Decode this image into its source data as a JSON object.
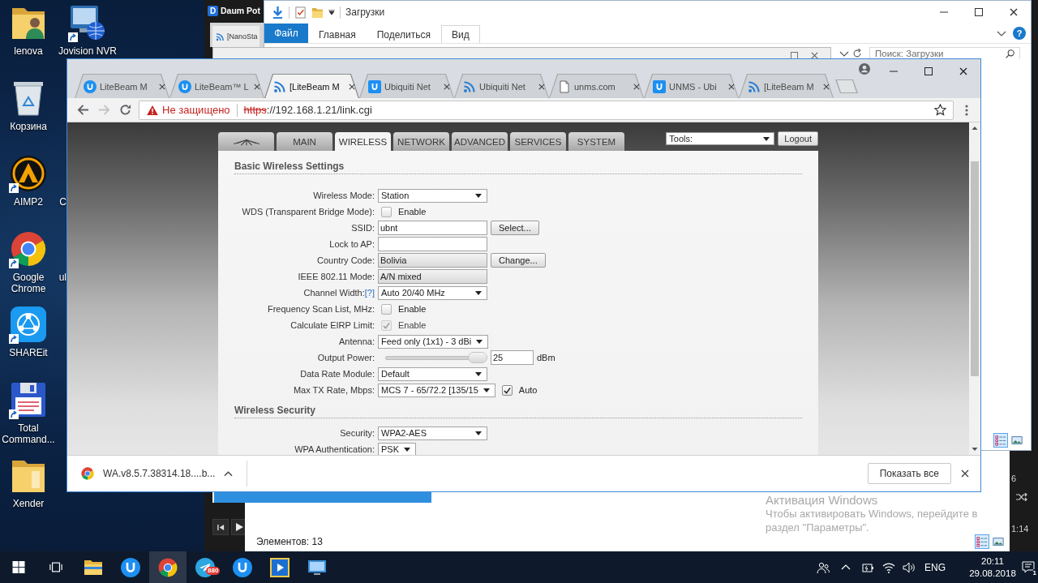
{
  "desktop": {
    "icons": [
      {
        "label": "lenova",
        "kind": "user-folder",
        "shortcut": false
      },
      {
        "label": "Jovision NVR",
        "kind": "nvr",
        "shortcut": true
      },
      {
        "label": "Корзина",
        "kind": "recycle-bin",
        "shortcut": false
      },
      {
        "label": "AIMP2",
        "kind": "aimp",
        "shortcut": true
      },
      {
        "label": "Google Chrome",
        "kind": "chrome",
        "shortcut": true
      },
      {
        "label": "SHAREit",
        "kind": "shareit",
        "shortcut": true
      },
      {
        "label": "Total Command...",
        "kind": "floppy",
        "shortcut": true
      },
      {
        "label": "Xender",
        "kind": "folder",
        "shortcut": false
      }
    ],
    "cut_labels": [
      "C",
      "ul"
    ]
  },
  "player_window": {
    "logo": "D",
    "title": "Daum Pot",
    "counter": "6",
    "time": "1:14"
  },
  "explorer_behind": {
    "status": "Элементов: 13",
    "views": [
      {
        "kind": "details",
        "selected": true
      },
      {
        "kind": "thumbnails",
        "selected": false
      }
    ]
  },
  "background_browser": {
    "tab": "[NanoSta"
  },
  "explorer": {
    "title": "Загрузки",
    "ribbon": [
      {
        "label": "Файл",
        "kind": "menu",
        "selected": false
      },
      {
        "label": "Главная",
        "kind": "tab",
        "selected": false
      },
      {
        "label": "Поделиться",
        "kind": "tab",
        "selected": false
      },
      {
        "label": "Вид",
        "kind": "tab",
        "selected": true
      }
    ],
    "help": "?",
    "search": {
      "placeholder": "Поиск: Загрузки"
    },
    "views": [
      {
        "kind": "details",
        "selected": true
      },
      {
        "kind": "thumbnails",
        "selected": false
      }
    ]
  },
  "browser": {
    "tabs": [
      {
        "title": "LiteBeam M",
        "kind": "ubiquiti-round",
        "selected": false
      },
      {
        "title": "LiteBeam™ L",
        "kind": "ubiquiti-round",
        "selected": false
      },
      {
        "title": "[LiteBeam M",
        "kind": "signal",
        "selected": true
      },
      {
        "title": "Ubiquiti Net",
        "kind": "ubiquiti-square",
        "selected": false
      },
      {
        "title": "Ubiquiti Net",
        "kind": "signal",
        "selected": false
      },
      {
        "title": "unms.com",
        "kind": "page",
        "selected": false
      },
      {
        "title": "UNMS - Ubi",
        "kind": "ubiquiti-square",
        "selected": false
      },
      {
        "title": "[LiteBeam M",
        "kind": "signal",
        "selected": false
      }
    ],
    "forward_disabled": true,
    "address": {
      "security": "Не защищено",
      "scheme": "https",
      "rest": "://192.168.1.21/link.cgi"
    },
    "page": {
      "nav": [
        {
          "label": "MAIN",
          "selected": false
        },
        {
          "label": "WIRELESS",
          "selected": true
        },
        {
          "label": "NETWORK",
          "selected": false
        },
        {
          "label": "ADVANCED",
          "selected": false
        },
        {
          "label": "SERVICES",
          "selected": false
        },
        {
          "label": "SYSTEM",
          "selected": false
        }
      ],
      "tools": "Tools:",
      "logout": "Logout",
      "sections": [
        {
          "title": "Basic Wireless Settings",
          "rows": [
            {
              "kind": "select",
              "label": "Wireless Mode:",
              "value": "Station",
              "disabled": false
            },
            {
              "kind": "checkbox",
              "label": "WDS (Transparent Bridge Mode):",
              "text": "Enable",
              "checked": false,
              "disabled": false
            },
            {
              "kind": "input",
              "label": "SSID:",
              "value": "ubnt",
              "button": "Select...",
              "disabled": false
            },
            {
              "kind": "input",
              "label": "Lock to AP:",
              "disabled": false
            },
            {
              "kind": "readonly",
              "label": "Country Code:",
              "value": "Bolivia",
              "button": "Change...",
              "disabled": false
            },
            {
              "kind": "readonly",
              "label": "IEEE 802.11 Mode:",
              "value": "A/N mixed",
              "disabled": false
            },
            {
              "kind": "select",
              "label": "Channel Width:",
              "help": "[?]",
              "value": "Auto 20/40 MHz",
              "disabled": false
            },
            {
              "kind": "checkbox",
              "label": "Frequency Scan List, MHz:",
              "text": "Enable",
              "checked": false,
              "disabled": false
            },
            {
              "kind": "checkbox",
              "label": "Calculate EIRP Limit:",
              "text": "Enable",
              "checked": true,
              "disabled": true
            },
            {
              "kind": "select",
              "label": "Antenna:",
              "value": "Feed only (1x1) - 3 dBi",
              "disabled": false
            },
            {
              "kind": "slider",
              "label": "Output Power:",
              "level": 1,
              "value": "25",
              "unit": "dBm",
              "disabled": false
            },
            {
              "kind": "select",
              "label": "Data Rate Module:",
              "value": "Default",
              "disabled": false
            },
            {
              "kind": "select",
              "label": "Max TX Rate, Mbps:",
              "value": "MCS 7 - 65/72.2 [135/15",
              "option": {
                "text": "Auto",
                "checked": true
              },
              "disabled": false
            }
          ]
        },
        {
          "title": "Wireless Security",
          "rows": [
            {
              "kind": "select",
              "label": "Security:",
              "value": "WPA2-AES",
              "disabled": false
            },
            {
              "kind": "small-select",
              "label": "WPA Authentication:",
              "value": "PSK",
              "disabled": false
            }
          ]
        }
      ]
    },
    "downloads": {
      "file": "WA.v8.5.7.38314.18....b...",
      "show_all": "Показать все"
    }
  },
  "activation": {
    "title": "Активация Windows",
    "text": "Чтобы активировать Windows, перейдите в раздел \"Параметры\"."
  },
  "taskbar": {
    "apps": [
      {
        "kind": "folder",
        "active": false
      },
      {
        "kind": "ubiquiti",
        "active": false
      },
      {
        "kind": "chrome",
        "active": true
      },
      {
        "kind": "telegram",
        "active": false,
        "badge": "880"
      },
      {
        "kind": "ubiquiti",
        "active": false
      },
      {
        "kind": "player",
        "active": false
      },
      {
        "kind": "remote-desktop",
        "active": false
      }
    ],
    "language": "ENG",
    "time": "20:11",
    "date": "29.08.2018",
    "notifications": "1"
  }
}
